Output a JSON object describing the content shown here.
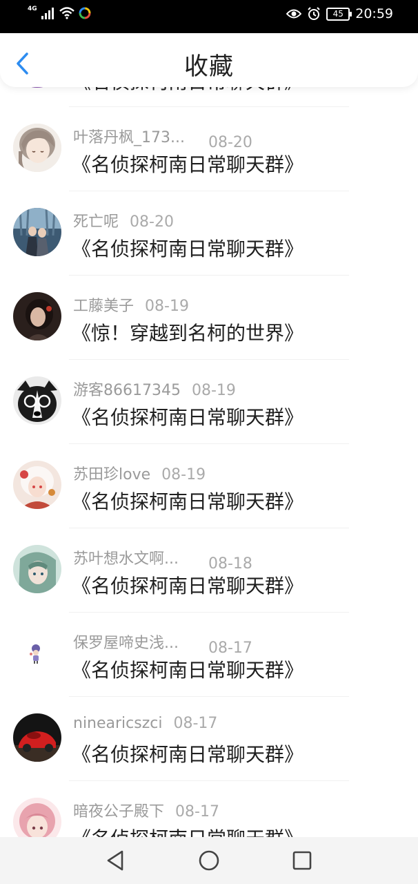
{
  "status_bar": {
    "network": "4G",
    "time": "20:59",
    "battery": "45",
    "icons": [
      "signal-icon",
      "wifi-icon",
      "app-notification-icon",
      "eye-icon",
      "alarm-icon",
      "battery-icon"
    ]
  },
  "header": {
    "title": "收藏",
    "back_icon": "back-arrow-icon",
    "accent_color": "#2d8cf0"
  },
  "partial_top_item": {
    "title": "《名侦探柯南日常聊天群》"
  },
  "items": [
    {
      "user": "叶落丹枫_173...",
      "date": "08-20",
      "title": "《名侦探柯南日常聊天群》",
      "avatar": "anime-girl-avatar"
    },
    {
      "user": "死亡呢",
      "date": "08-20",
      "title": "《名侦探柯南日常聊天群》",
      "avatar": "couple-scene-avatar"
    },
    {
      "user": "工藤美子",
      "date": "08-19",
      "title": "《惊！穿越到名柯的世界》",
      "avatar": "dark-portrait-avatar"
    },
    {
      "user": "游客86617345",
      "date": "08-19",
      "title": "《名侦探柯南日常聊天群》",
      "avatar": "dog-glasses-avatar"
    },
    {
      "user": "苏田珍love",
      "date": "08-19",
      "title": "《名侦探柯南日常聊天群》",
      "avatar": "anime-white-hair-avatar"
    },
    {
      "user": "苏叶想水文啊...",
      "date": "08-18",
      "title": "《名侦探柯南日常聊天群》",
      "avatar": "anime-green-hair-avatar"
    },
    {
      "user": "保罗屋啼史浅...",
      "date": "08-17",
      "title": "《名侦探柯南日常聊天群》",
      "avatar": "small-character-avatar"
    },
    {
      "user": "ninearicszci",
      "date": "08-17",
      "title": "《名侦探柯南日常聊天群》",
      "avatar": "red-toy-car-avatar"
    },
    {
      "user": "暗夜公子殿下",
      "date": "08-17",
      "title": "《名侦探柯南日常聊天群》",
      "avatar": "pink-hair-avatar"
    }
  ],
  "nav_bar": {
    "icons": [
      "back-triangle-icon",
      "home-circle-icon",
      "recents-square-icon"
    ]
  }
}
